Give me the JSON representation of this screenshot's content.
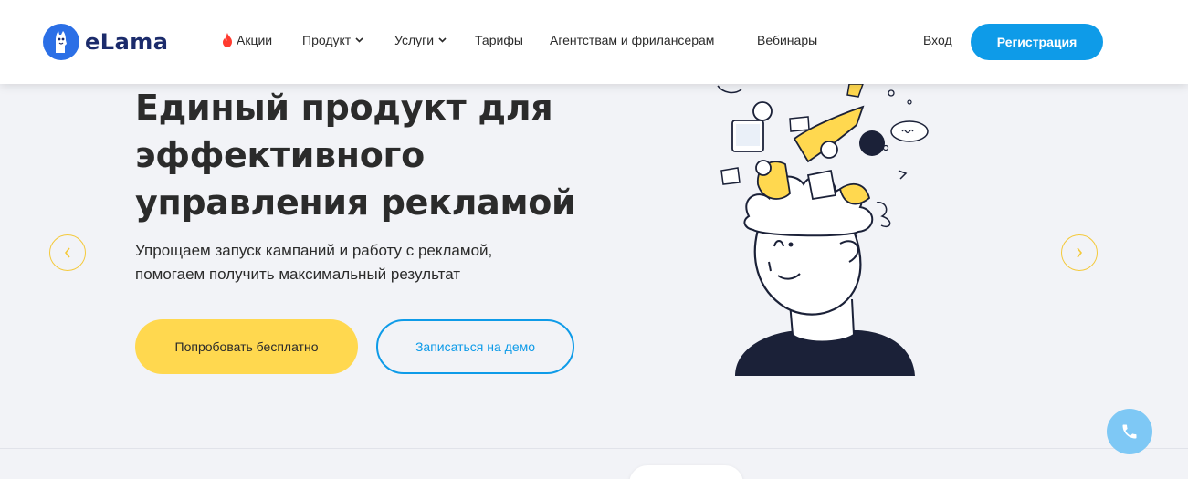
{
  "header": {
    "logo_text": "eLama",
    "nav": [
      {
        "label": "Акции",
        "icon": "fire-icon"
      },
      {
        "label": "Продукт",
        "icon": "chevron-down-icon"
      },
      {
        "label": "Услуги",
        "icon": "chevron-down-icon"
      },
      {
        "label": "Тарифы"
      },
      {
        "label": "Агентствам и фрилансерам"
      },
      {
        "label": "Вебинары"
      }
    ],
    "login_label": "Вход",
    "register_label": "Регистрация"
  },
  "hero": {
    "title_lines": [
      "Единый продукт для",
      "эффективного",
      "управления рекламой"
    ],
    "subtitle_lines": [
      "Упрощаем запуск кампаний и работу с рекламой,",
      "помогаем получить максимальный результат"
    ],
    "cta_primary": "Попробовать бесплатно",
    "cta_secondary": "Записаться на демо"
  },
  "carousel": {
    "prev_icon": "chevron-left-icon",
    "next_icon": "chevron-right-icon"
  },
  "widgets": {
    "call_icon": "phone-icon"
  },
  "colors": {
    "brand_blue": "#0e9be8",
    "brand_yellow": "#ffd84f",
    "logo_blue": "#2b6fe6",
    "navy": "#1b2b6b",
    "background": "#f2f3f7"
  }
}
